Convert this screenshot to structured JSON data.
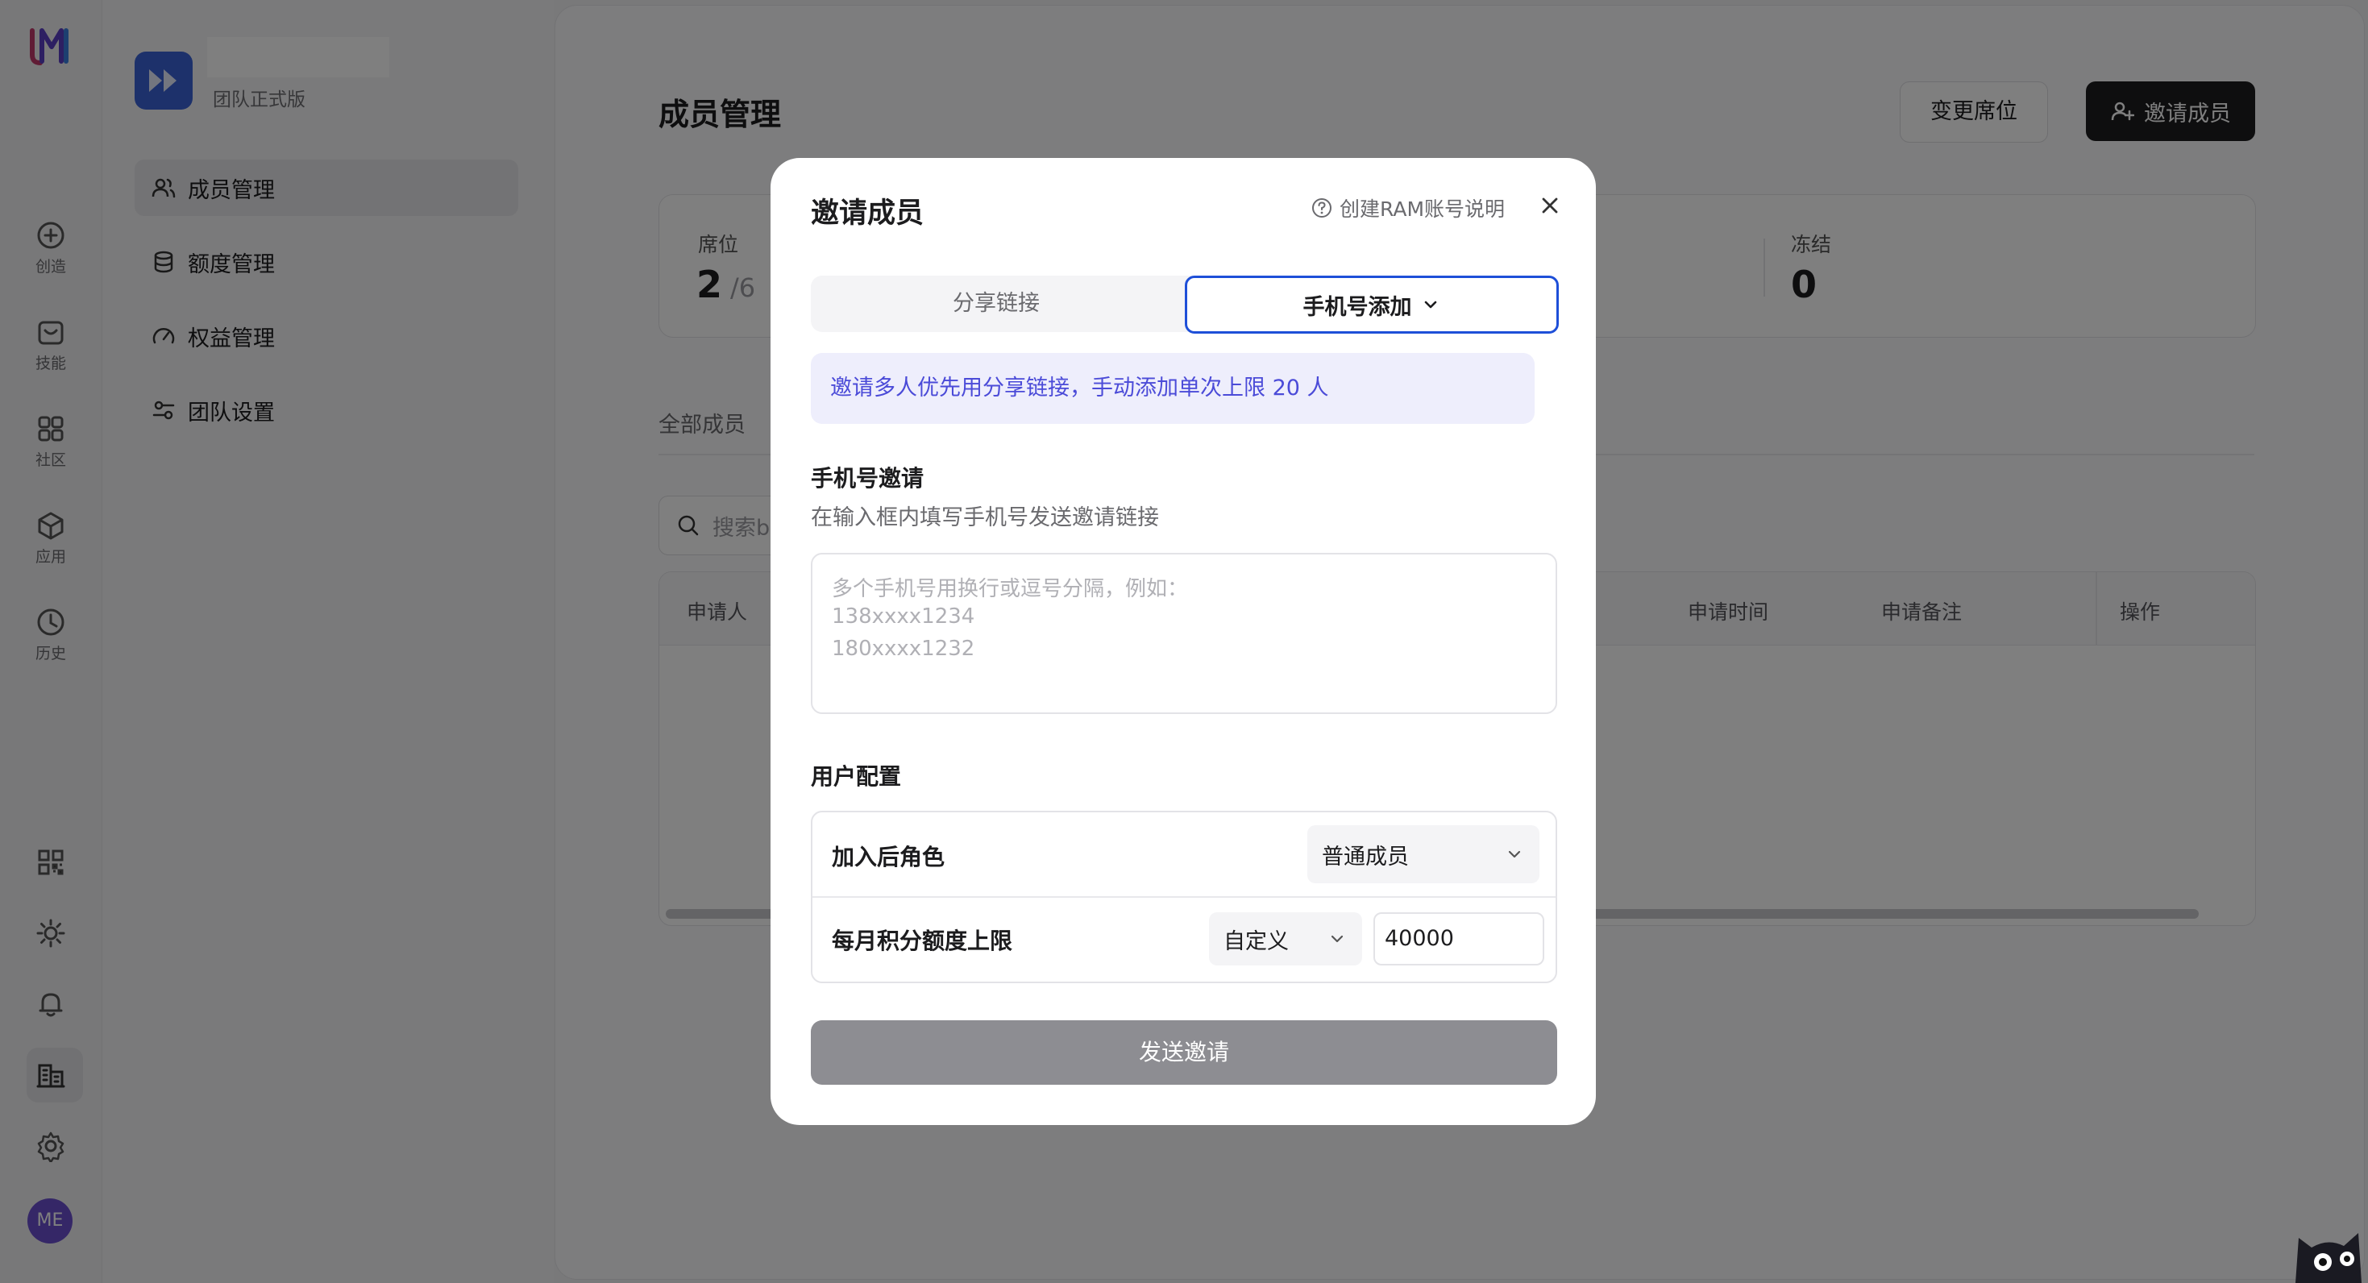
{
  "rail": {
    "items": [
      {
        "label": "创造",
        "icon": "plus-circle-icon"
      },
      {
        "label": "技能",
        "icon": "skill-box-icon"
      },
      {
        "label": "社区",
        "icon": "grid-icon"
      },
      {
        "label": "应用",
        "icon": "cube-icon"
      },
      {
        "label": "历史",
        "icon": "clock-icon"
      }
    ],
    "avatar": "ME"
  },
  "side": {
    "plan": "团队正式版",
    "nav": [
      {
        "label": "成员管理",
        "icon": "users-icon"
      },
      {
        "label": "额度管理",
        "icon": "database-icon"
      },
      {
        "label": "权益管理",
        "icon": "gauge-icon"
      },
      {
        "label": "团队设置",
        "icon": "sliders-icon"
      }
    ]
  },
  "main": {
    "title": "成员管理",
    "change_seats": "变更席位",
    "invite": "邀请成员",
    "stats": {
      "seat_label": "席位",
      "seat_value": "2",
      "seat_total": "/6",
      "frozen_label": "冻结",
      "frozen_value": "0"
    },
    "tab_all": "全部成员",
    "search_placeholder": "搜索b",
    "columns": {
      "applicant": "申请人",
      "time": "申请时间",
      "note": "申请备注",
      "ops": "操作"
    }
  },
  "modal": {
    "title": "邀请成员",
    "help": "创建RAM账号说明",
    "seg_share": "分享链接",
    "seg_phone": "手机号添加",
    "notice": "邀请多人优先用分享链接，手动添加单次上限 20 人",
    "phone_title": "手机号邀请",
    "phone_desc": "在输入框内填写手机号发送邀请链接",
    "placeholder_lines": [
      "多个手机号用换行或逗号分隔，例如：",
      "138xxxx1234",
      "180xxxx1232"
    ],
    "config_title": "用户配置",
    "role_label": "加入后角色",
    "role_value": "普通成员",
    "quota_label": "每月积分额度上限",
    "quota_mode": "自定义",
    "quota_value": "40000",
    "send": "发送邀请"
  },
  "colors": {
    "accent": "#1e4fd8",
    "notice_text": "#4b4bd8",
    "notice_bg": "#eeeefc",
    "dark_button": "#1c1c1e"
  }
}
